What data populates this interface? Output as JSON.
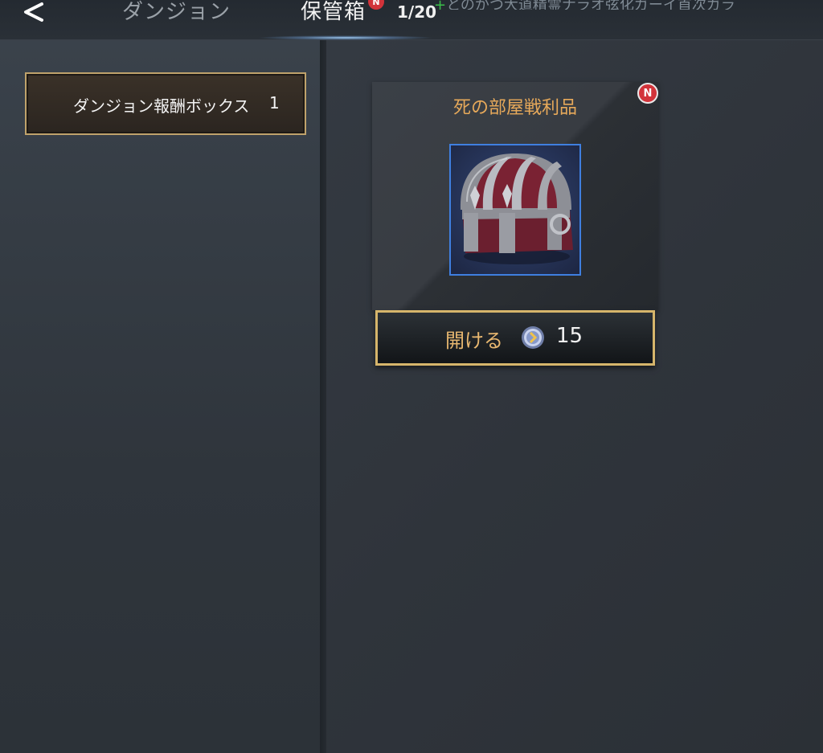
{
  "header": {
    "back_icon": "chevron-left-icon",
    "tabs": [
      {
        "label": "ダンジョン",
        "active": false
      },
      {
        "label": "保管箱",
        "active": true
      }
    ],
    "tab_notification": "N",
    "capacity": "1/20",
    "ticker_text": "とのかつ大道精霊ナラオ弦化ガーイ首次ガラ"
  },
  "sidebar": {
    "items": [
      {
        "label": "ダンジョン報酬ボックス",
        "count": "1",
        "selected": true
      }
    ]
  },
  "main": {
    "items": [
      {
        "name": "死の部屋戦利品",
        "badge": "N",
        "image_icon": "treasure-chest-icon",
        "action_label": "開ける",
        "currency_icon": "coin-icon",
        "cost": "15"
      }
    ]
  },
  "colors": {
    "accent_gold": "#d6b56b",
    "title_orange": "#e7a95a",
    "badge_red": "#d2333a",
    "selection_blue": "#3f7fe0"
  }
}
